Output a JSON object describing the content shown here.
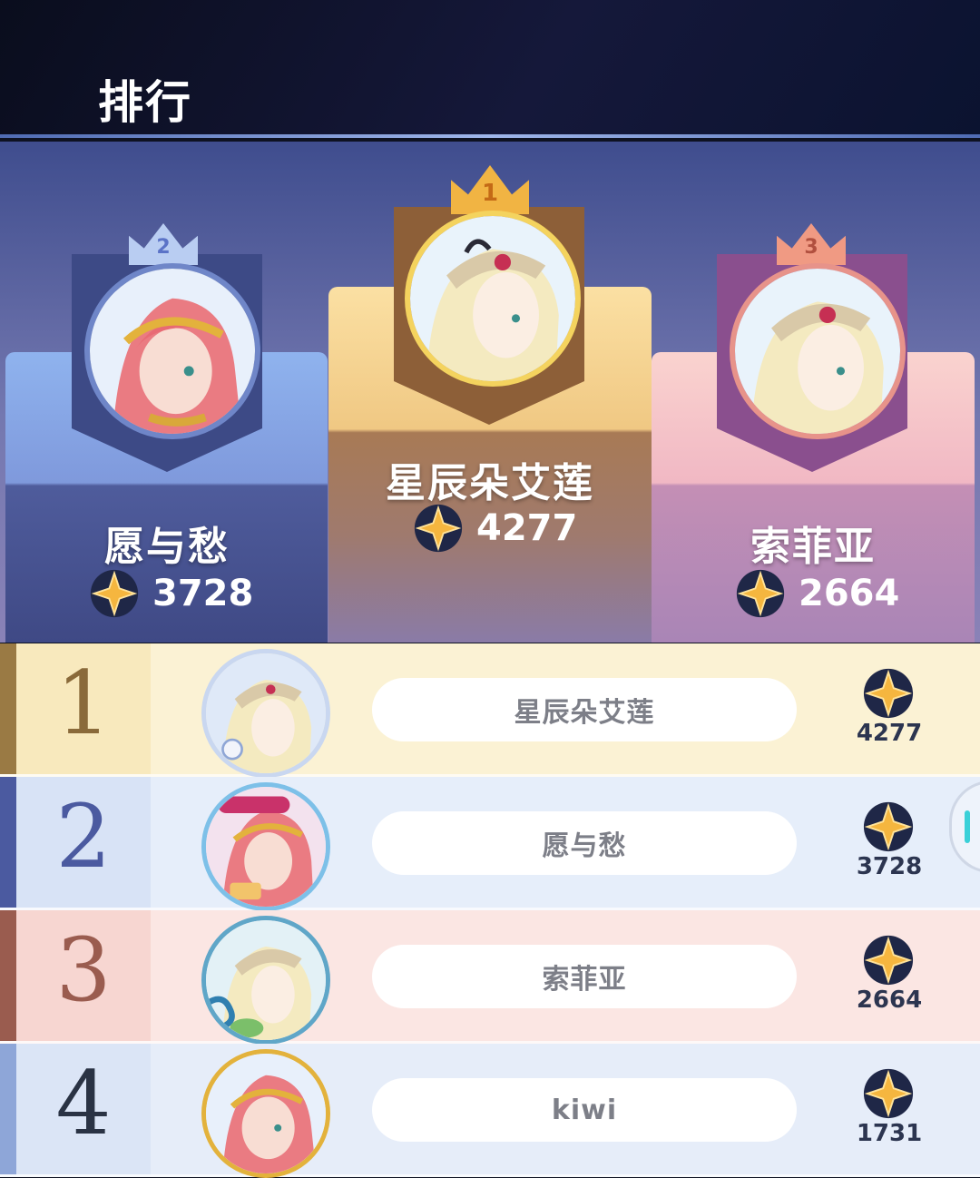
{
  "header": {
    "title": "排行"
  },
  "podium": [
    {
      "place": 2,
      "crown_label": "2",
      "name": "愿与愁",
      "score": "3728",
      "avatar_icon": "red-hair-laurel-avatar-icon"
    },
    {
      "place": 1,
      "crown_label": "1",
      "name": "星辰朵艾莲",
      "score": "4277",
      "avatar_icon": "blonde-tiara-avatar-icon"
    },
    {
      "place": 3,
      "crown_label": "3",
      "name": "索菲亚",
      "score": "2664",
      "avatar_icon": "blonde-tiara-avatar-icon"
    }
  ],
  "list": [
    {
      "rank": "1",
      "name": "星辰朵艾莲",
      "score": "4277",
      "avatar_icon": "blonde-tiara-frame-avatar-icon"
    },
    {
      "rank": "2",
      "name": "愿与愁",
      "score": "3728",
      "avatar_icon": "red-hair-anniversary-frame-avatar-icon"
    },
    {
      "rank": "3",
      "name": "索菲亚",
      "score": "2664",
      "avatar_icon": "blonde-tiara-wave-frame-avatar-icon"
    },
    {
      "rank": "4",
      "name": "kiwi",
      "score": "1731",
      "avatar_icon": "red-hair-laurel-avatar-icon"
    }
  ],
  "colors": {
    "gold": "#f1b443",
    "silver_blue": "#8ea9e8",
    "bronze_pink": "#f09a83",
    "rank1_bg": "#fbf2d4",
    "rank2_bg": "#e6eefa",
    "rank3_bg": "#fbe6e3",
    "rank4_bg": "#e6edf9",
    "rank1_num": "#8a6a3a",
    "rank2_num": "#4b5aa0",
    "rank3_num": "#9a5c4f",
    "rank4_num": "#2a3344"
  },
  "icons": {
    "score": "star-coin-icon",
    "rank_crown": "crown-icon"
  }
}
